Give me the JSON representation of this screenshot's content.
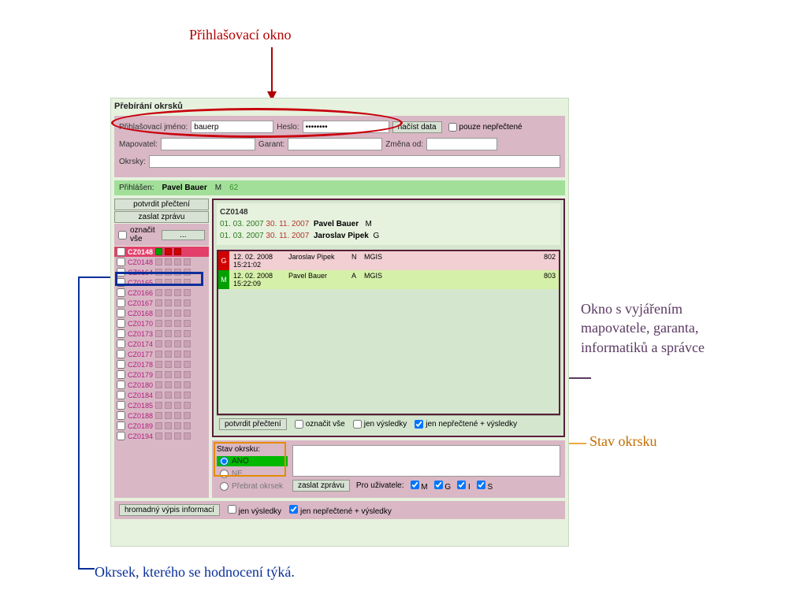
{
  "annotations": {
    "login": "Přihlašovací okno",
    "okno": "Okno s vyjářením mapovatele, garanta, informatiků a správce",
    "stav": "Stav okrsku",
    "okrsek": "Okrsek, kterého se hodnocení týká."
  },
  "title": "Přebírání okrsků",
  "login": {
    "jmeno_label": "Přihlašovací jméno:",
    "jmeno_value": "bauerp",
    "heslo_label": "Heslo:",
    "heslo_value": "********",
    "nacist": "načíst data",
    "pouze_neprectene": "pouze nepřečtené"
  },
  "filters": {
    "mapovatel": "Mapovatel:",
    "garant": "Garant:",
    "zmena_od": "Změna od:",
    "okrsky": "Okrsky:"
  },
  "status": {
    "prihlasen_lbl": "Přihlášen:",
    "user": "Pavel Bauer",
    "role": "M",
    "count": "62"
  },
  "left": {
    "potvrdit": "potvrdit přečtení",
    "zaslat": "zaslat zprávu",
    "oznacit_vse": "označit vše",
    "dots": "..."
  },
  "okrsky": [
    {
      "code": "CZ0148",
      "selected": true
    },
    {
      "code": "CZ0148"
    },
    {
      "code": "CZ0164"
    },
    {
      "code": "CZ0165"
    },
    {
      "code": "CZ0166"
    },
    {
      "code": "CZ0167"
    },
    {
      "code": "CZ0168"
    },
    {
      "code": "CZ0170"
    },
    {
      "code": "CZ0173"
    },
    {
      "code": "CZ0174"
    },
    {
      "code": "CZ0177"
    },
    {
      "code": "CZ0178"
    },
    {
      "code": "CZ0179"
    },
    {
      "code": "CZ0180"
    },
    {
      "code": "CZ0184"
    },
    {
      "code": "CZ0185"
    },
    {
      "code": "CZ0188"
    },
    {
      "code": "CZ0189"
    },
    {
      "code": "CZ0194"
    }
  ],
  "detail": {
    "id": "CZ0148",
    "rows": [
      {
        "d1": "01. 03. 2007",
        "d2": "30. 11. 2007",
        "name": "Pavel Bauer",
        "role": "M"
      },
      {
        "d1": "01. 03. 2007",
        "d2": "30. 11. 2007",
        "name": "Jaroslav Pipek",
        "role": "G"
      }
    ],
    "messages": [
      {
        "flag": "G",
        "flag_color": "red",
        "date": "12. 02. 2008",
        "time": "15:21:02",
        "name": "Jaroslav Pipek",
        "c1": "N",
        "c2": "MGIS",
        "id": "802"
      },
      {
        "flag": "M",
        "flag_color": "green",
        "date": "12. 02. 2008",
        "time": "15:22:09",
        "name": "Pavel Bauer",
        "c1": "A",
        "c2": "MGIS",
        "id": "803"
      }
    ],
    "foot": {
      "potvrdit": "potvrdit přečtení",
      "oznacit_vse": "označit vše",
      "jen_vysledky": "jen výsledky",
      "jen_neprectene": "jen nepřečtené + výsledky"
    }
  },
  "stav": {
    "label": "Stav okrsku:",
    "ano": "ANO",
    "ne": "NE",
    "prebrat": "Přebrat okrsek",
    "zaslat": "zaslat zprávu",
    "pro_uzivatele": "Pro uživatele:",
    "opts": {
      "m": "M",
      "g": "G",
      "i": "I",
      "s": "S"
    }
  },
  "footer": {
    "hromadny": "hromadný výpis informací",
    "jen_vysledky": "jen výsledky",
    "jen_neprectene": "jen nepřečtené + výsledky"
  }
}
